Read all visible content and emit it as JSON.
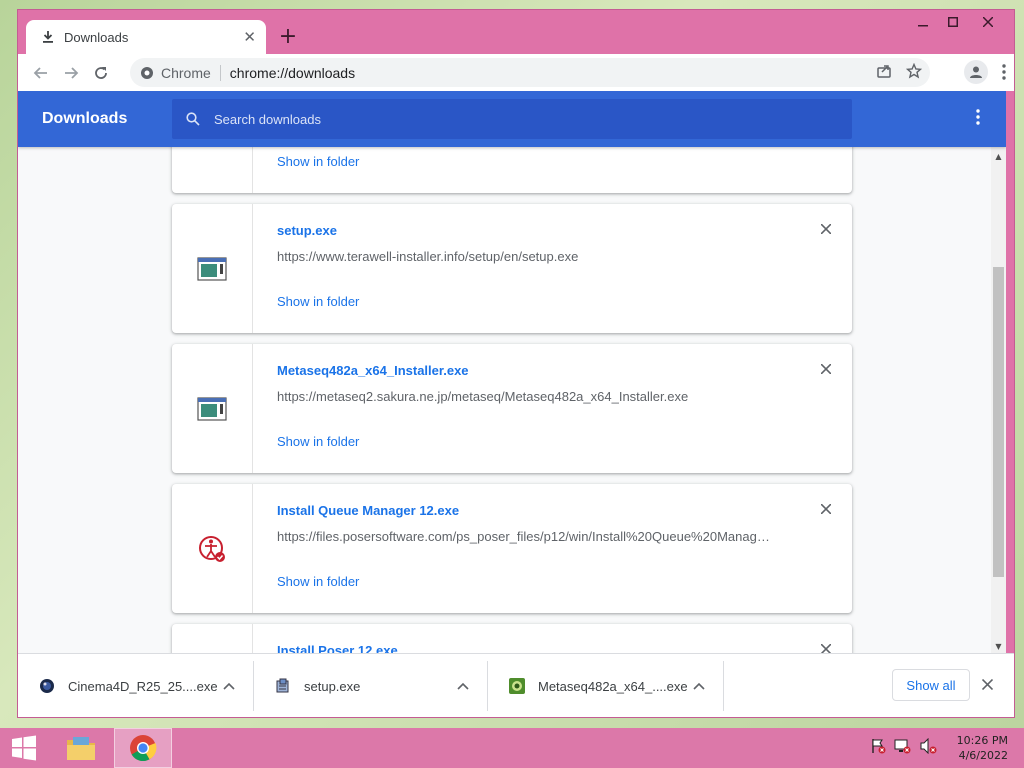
{
  "window": {
    "tab_title": "Downloads",
    "tab_close": "✕",
    "new_tab": "+",
    "controls": {
      "minimize": "🗕",
      "maximize": "🗖",
      "close": "✕"
    }
  },
  "toolbar": {
    "chip_label": "Chrome",
    "url": "chrome://downloads"
  },
  "page": {
    "title": "Downloads",
    "search_placeholder": "Search downloads"
  },
  "downloads": [
    {
      "name": "",
      "url": "",
      "action": "Show in folder",
      "icon": "file-icon"
    },
    {
      "name": "setup.exe",
      "url": "https://www.terawell-installer.info/setup/en/setup.exe",
      "action": "Show in folder",
      "icon": "exe-window-icon"
    },
    {
      "name": "Metaseq482a_x64_Installer.exe",
      "url": "https://metaseq2.sakura.ne.jp/metaseq/Metaseq482a_x64_Installer.exe",
      "action": "Show in folder",
      "icon": "exe-window-icon"
    },
    {
      "name": "Install Queue Manager 12.exe",
      "url": "https://files.posersoftware.com/ps_poser_files/p12/win/Install%20Queue%20Manag…",
      "action": "Show in folder",
      "icon": "poser-icon"
    },
    {
      "name": "Install Poser 12.exe",
      "url": "",
      "action": "",
      "icon": "poser-icon"
    }
  ],
  "shelf": {
    "items": [
      {
        "name": "Cinema4D_R25_25....exe",
        "icon": "cinema4d-icon"
      },
      {
        "name": "setup.exe",
        "icon": "installer-icon"
      },
      {
        "name": "Metaseq482a_x64_....exe",
        "icon": "metaseq-icon"
      }
    ],
    "show_all": "Show all"
  },
  "taskbar": {
    "time": "10:26 PM",
    "date": "4/6/2022"
  },
  "colors": {
    "accent": "#3367d6",
    "link": "#1a73e8",
    "window_frame": "#df72a8",
    "taskbar": "#dc78a9"
  }
}
